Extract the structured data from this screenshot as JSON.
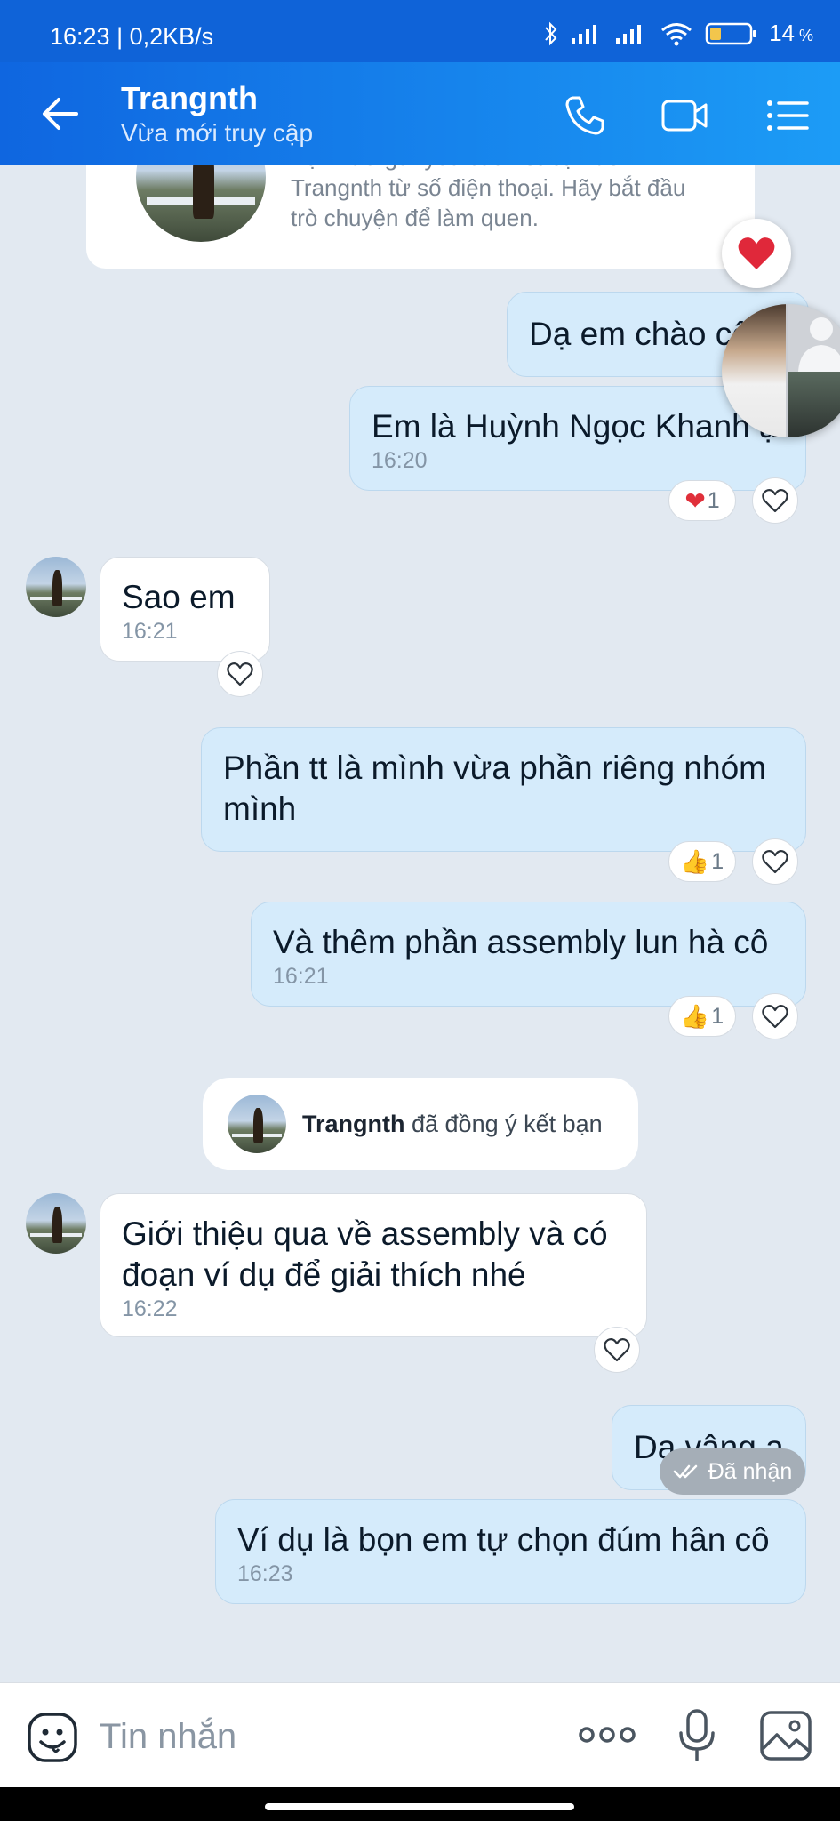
{
  "status_bar": {
    "time": "16:23 | 0,2KB/s",
    "battery": "14"
  },
  "header": {
    "title": "Trangnth",
    "subtitle": "Vừa mới truy cập"
  },
  "intro_card": {
    "text_line1": "Bạn vừa gửi yêu cầu kết bạn đến",
    "text_line2": "Trangnth từ số điện thoại. Hãy bắt đầu",
    "text_line3": "trò chuyện để làm quen."
  },
  "messages": [
    {
      "direction": "out",
      "text": "Dạ em chào cô"
    },
    {
      "direction": "out",
      "text": "Em là Huỳnh Ngọc Khanh ạ",
      "time": "16:20",
      "reaction": "❤",
      "reaction_count": "1"
    },
    {
      "direction": "in",
      "text": "Sao em",
      "time": "16:21"
    },
    {
      "direction": "out",
      "text": "Phần tt là mình vừa phần riêng nhóm mình",
      "reaction": "👍",
      "reaction_count": "1"
    },
    {
      "direction": "out",
      "text": "Và thêm phần assembly lun hà cô",
      "time": "16:21",
      "reaction": "👍",
      "reaction_count": "1"
    },
    {
      "direction": "in",
      "text": "Giới thiệu qua về assembly và có đoạn ví dụ để giải thích nhé",
      "time": "16:22"
    },
    {
      "direction": "out",
      "text": "Dạ vâng ạ"
    },
    {
      "direction": "out",
      "text": "Ví dụ là bọn em tự chọn đúm hân cô",
      "time": "16:23"
    }
  ],
  "system_message": {
    "name": "Trangnth",
    "text": " đã đồng ý kết bạn"
  },
  "delivery_status": "Đã nhận",
  "composer": {
    "placeholder": "Tin nhắn"
  },
  "colors": {
    "header_start": "#0f66e0",
    "header_end": "#1c9cf6",
    "outgoing_bubble": "#d5ebfb",
    "incoming_bubble": "#ffffff",
    "chat_bg": "#e2e9f1"
  }
}
